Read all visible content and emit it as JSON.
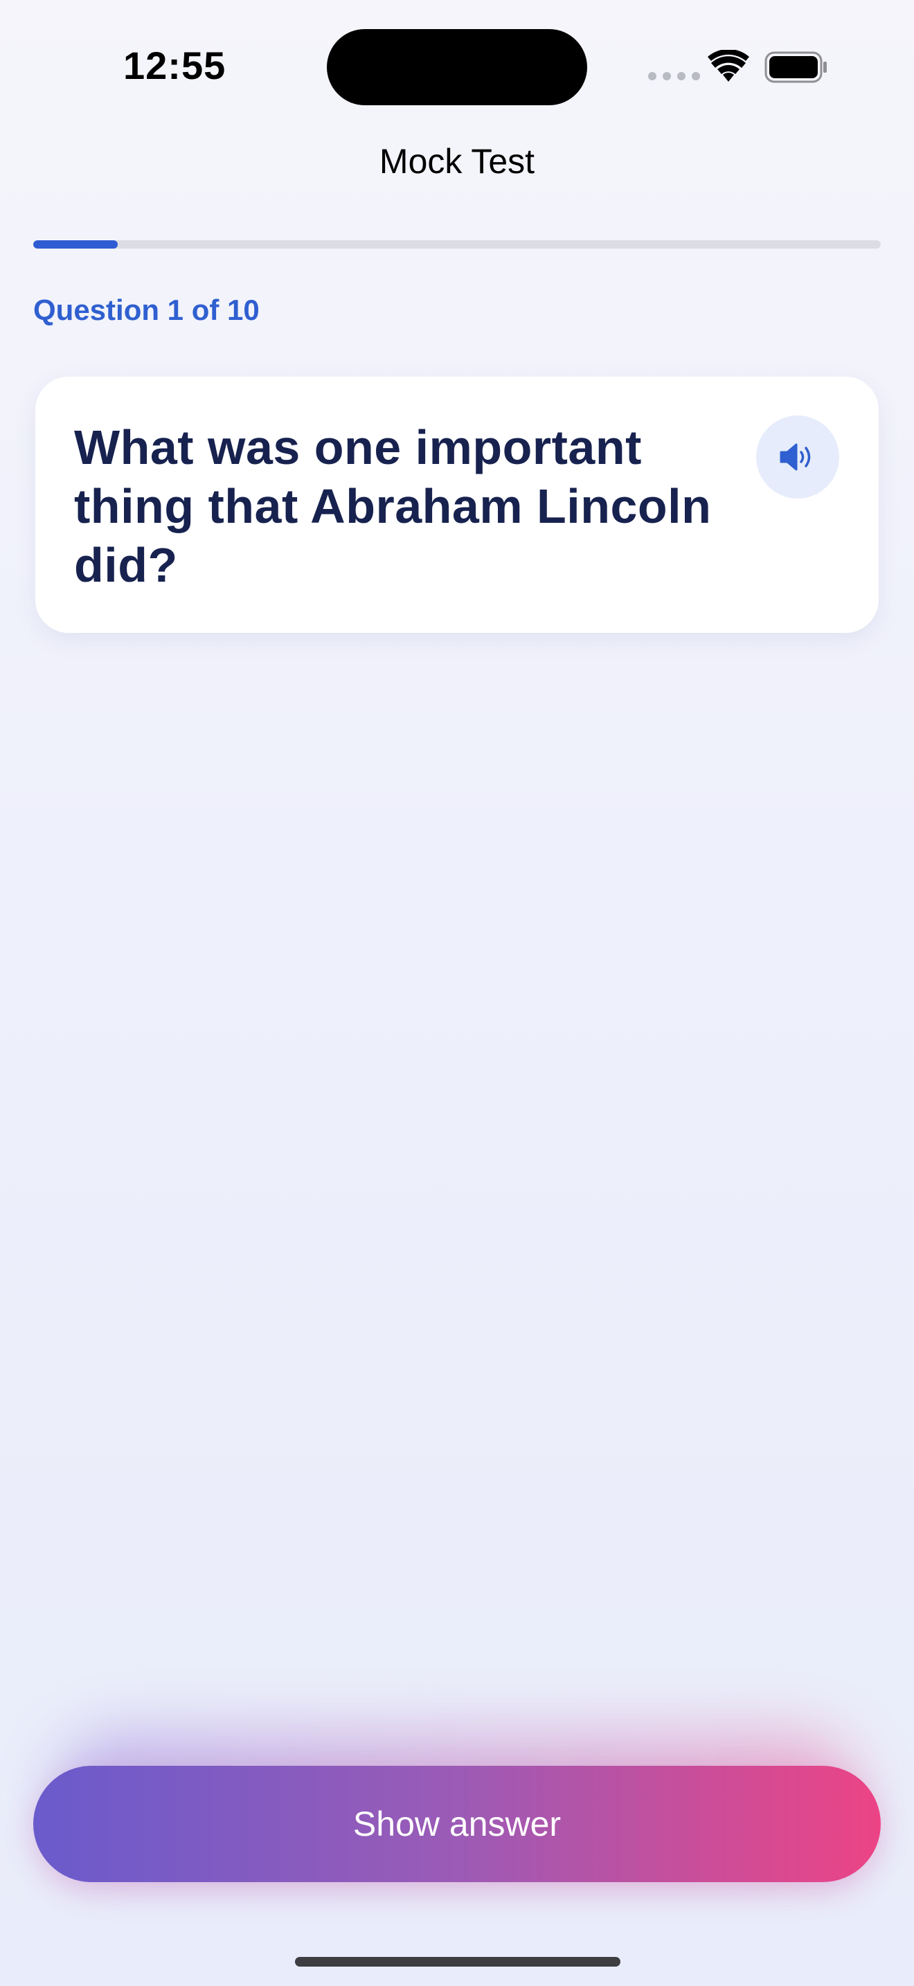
{
  "status_bar": {
    "time": "12:55",
    "signal_icon": "cellular-signal-icon",
    "wifi_icon": "wifi-icon",
    "battery_icon": "battery-full-icon"
  },
  "nav": {
    "title": "Mock Test"
  },
  "progress": {
    "current": 1,
    "total": 10,
    "fraction": 0.1,
    "label": "Question 1 of 10",
    "fill_color": "#2f5bd3"
  },
  "question": {
    "text": "What was one important thing that Abraham Lincoln did?",
    "speaker_icon": "speaker-icon"
  },
  "actions": {
    "show_answer_label": "Show answer"
  },
  "colors": {
    "accent": "#2f5fd0",
    "question_text": "#17224f",
    "button_gradient_start": "#6a5bcc",
    "button_gradient_end": "#ec4485"
  }
}
